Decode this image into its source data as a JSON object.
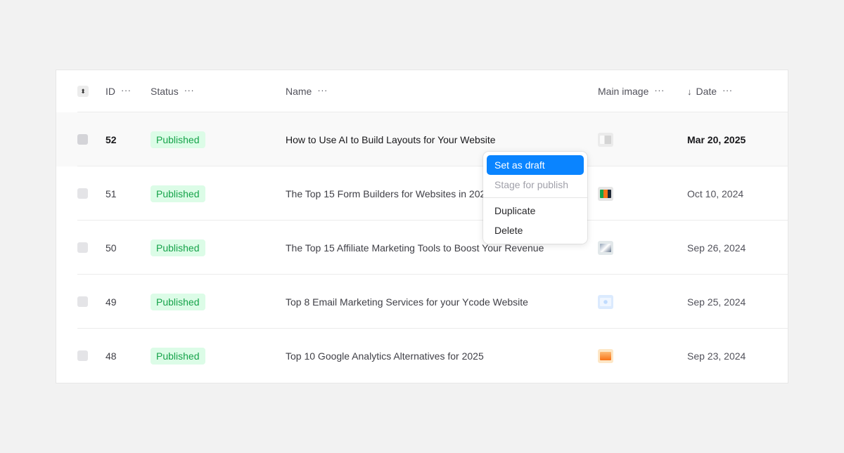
{
  "header": {
    "id_label": "ID",
    "status_label": "Status",
    "name_label": "Name",
    "image_label": "Main image",
    "date_label": "Date",
    "more_glyph": "···",
    "sort_glyph": "⬍",
    "date_sort_glyph": "↓"
  },
  "rows": [
    {
      "id": "52",
      "status": "Published",
      "name": "How to Use AI to Build Layouts for Your Website",
      "date": "Mar 20, 2025"
    },
    {
      "id": "51",
      "status": "Published",
      "name": "The Top 15 Form Builders for Websites in 2025",
      "date": "Oct 10, 2024"
    },
    {
      "id": "50",
      "status": "Published",
      "name": "The Top 15 Affiliate Marketing Tools to Boost Your Revenue",
      "date": "Sep 26, 2024"
    },
    {
      "id": "49",
      "status": "Published",
      "name": "Top 8 Email Marketing Services for your Ycode Website",
      "date": "Sep 25, 2024"
    },
    {
      "id": "48",
      "status": "Published",
      "name": "Top 10 Google Analytics Alternatives for 2025",
      "date": "Sep 23, 2024"
    }
  ],
  "context_menu": {
    "items": [
      "Set as draft",
      "Stage for publish",
      "Duplicate",
      "Delete"
    ]
  },
  "colors": {
    "accent": "#0a84ff",
    "badge_bg": "#dcfce7",
    "badge_text": "#16a34a"
  }
}
